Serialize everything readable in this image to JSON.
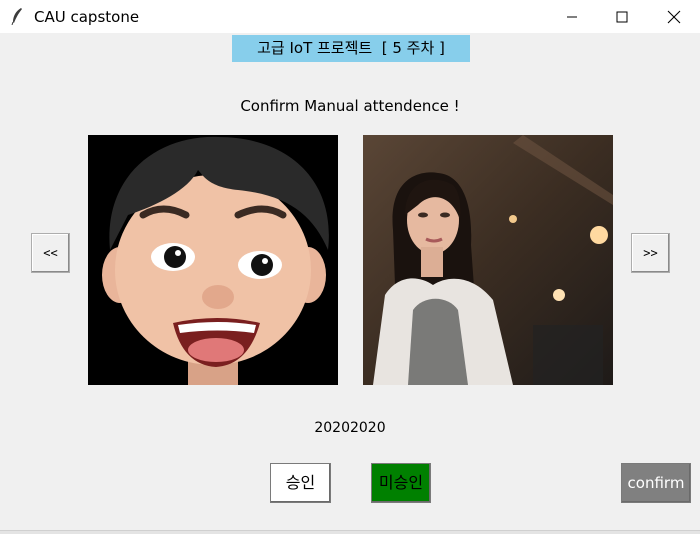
{
  "window": {
    "title": "CAU capstone",
    "icon": "feather-icon",
    "controls": {
      "minimize": "minimize-icon",
      "maximize": "maximize-icon",
      "close": "close-icon"
    }
  },
  "header": {
    "course_label": "고급 IoT 프로젝트  [ 5 주차 ]",
    "background": "#87ceeb"
  },
  "subtitle": "Confirm Manual attendence !",
  "navigation": {
    "prev_label": "<<",
    "next_label": ">>"
  },
  "photos": {
    "reference": {
      "kind": "memoji avatar",
      "background": "#000000"
    },
    "captured": {
      "kind": "webcam photo"
    }
  },
  "student_id": "20202020",
  "actions": {
    "approve_label": "승인",
    "reject_label": "미승인",
    "confirm_label": "confirm",
    "approve_color": "#ffffff",
    "reject_color": "#008000",
    "confirm_color": "#808080"
  }
}
